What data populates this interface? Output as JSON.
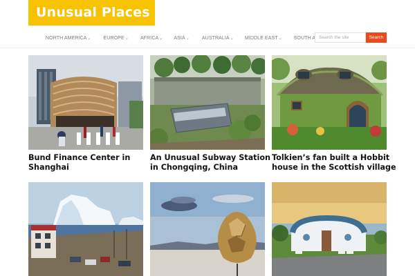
{
  "site": {
    "logo": "Unusual Places"
  },
  "nav": {
    "items": [
      {
        "label": "NORTH AMERICA",
        "icon": "chevron-down-icon"
      },
      {
        "label": "EUROPE",
        "icon": "chevron-down-icon"
      },
      {
        "label": "AFRICA",
        "icon": "chevron-down-icon"
      },
      {
        "label": "ASIA",
        "icon": "chevron-down-icon"
      },
      {
        "label": "AUSTRALIA",
        "icon": "chevron-down-icon"
      },
      {
        "label": "MIDDLE EAST",
        "icon": "chevron-down-icon"
      },
      {
        "label": "SOUTH AMERICA",
        "icon": "chevron-down-icon"
      }
    ]
  },
  "search": {
    "placeholder": "Search the site",
    "button_label": "Search"
  },
  "posts": [
    {
      "title_line1": "Bund Finance Center in",
      "title_line2": "Shanghai"
    },
    {
      "title_line1": "An Unusual Subway Station",
      "title_line2": "in Chongqing, China"
    },
    {
      "title_line1": "Tolkien’s fan built a Hobbit",
      "title_line2": "house in the Scottish village"
    },
    {
      "title_line1": "",
      "title_line2": ""
    },
    {
      "title_line1": "",
      "title_line2": ""
    },
    {
      "title_line1": "",
      "title_line2": ""
    }
  ],
  "colors": {
    "logo_bg": "#f7c200",
    "accent": "#e8491d"
  }
}
